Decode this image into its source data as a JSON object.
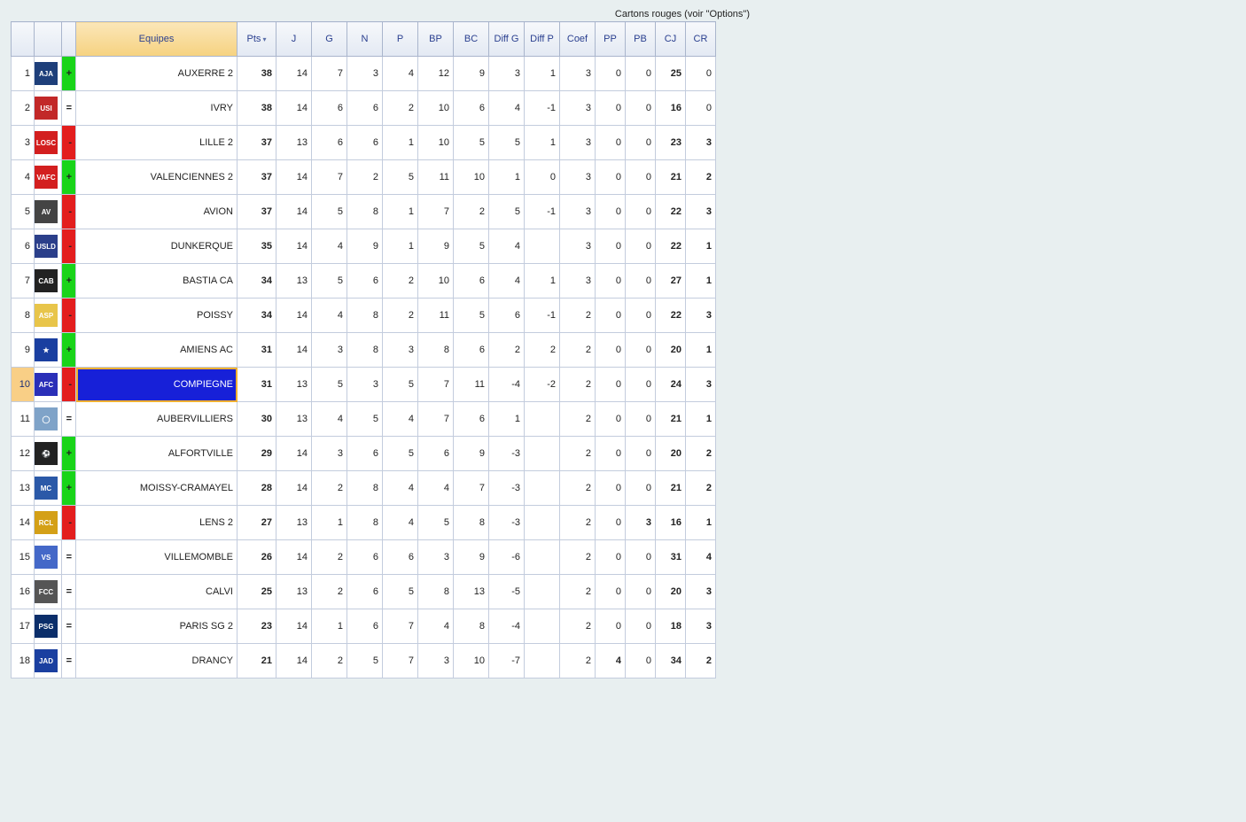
{
  "top_note": "Cartons rouges (voir \"Options\")",
  "columns": {
    "rank": "",
    "logo": "",
    "trend": "",
    "team": "Equipes",
    "pts": "Pts",
    "j": "J",
    "g": "G",
    "n": "N",
    "p": "P",
    "bp": "BP",
    "bc": "BC",
    "diffg": "Diff G",
    "diffp": "Diff P",
    "coef": "Coef",
    "pp": "PP",
    "pb": "PB",
    "cj": "CJ",
    "cr": "CR"
  },
  "sort_indicator": "▾",
  "rows": [
    {
      "rank": 1,
      "trend": "up",
      "team": "AUXERRE 2",
      "pts": 38,
      "j": 14,
      "g": 7,
      "n": 3,
      "p": 4,
      "bp": 12,
      "bc": 9,
      "diffg": 3,
      "diffp": 1,
      "coef": 3,
      "pp": 0,
      "pb": 0,
      "cj": 25,
      "cr": 0,
      "logo_bg": "#1e3f7a",
      "logo_tx": "AJA"
    },
    {
      "rank": 2,
      "trend": "eq",
      "team": "IVRY",
      "pts": 38,
      "j": 14,
      "g": 6,
      "n": 6,
      "p": 2,
      "bp": 10,
      "bc": 6,
      "diffg": 4,
      "diffp": -1,
      "coef": 3,
      "pp": 0,
      "pb": 0,
      "cj": 16,
      "cr": 0,
      "logo_bg": "#c22828",
      "logo_tx": "USI"
    },
    {
      "rank": 3,
      "trend": "down",
      "team": "LILLE 2",
      "pts": 37,
      "j": 13,
      "g": 6,
      "n": 6,
      "p": 1,
      "bp": 10,
      "bc": 5,
      "diffg": 5,
      "diffp": 1,
      "coef": 3,
      "pp": 0,
      "pb": 0,
      "cj": 23,
      "cr": 3,
      "logo_bg": "#d31f1f",
      "logo_tx": "LOSC"
    },
    {
      "rank": 4,
      "trend": "up",
      "team": "VALENCIENNES 2",
      "pts": 37,
      "j": 14,
      "g": 7,
      "n": 2,
      "p": 5,
      "bp": 11,
      "bc": 10,
      "diffg": 1,
      "diffp": 0,
      "coef": 3,
      "pp": 0,
      "pb": 0,
      "cj": 21,
      "cr": 2,
      "logo_bg": "#d31f1f",
      "logo_tx": "VAFC"
    },
    {
      "rank": 5,
      "trend": "down",
      "team": "AVION",
      "pts": 37,
      "j": 14,
      "g": 5,
      "n": 8,
      "p": 1,
      "bp": 7,
      "bc": 2,
      "diffg": 5,
      "diffp": -1,
      "coef": 3,
      "pp": 0,
      "pb": 0,
      "cj": 22,
      "cr": 3,
      "logo_bg": "#444",
      "logo_tx": "AV"
    },
    {
      "rank": 6,
      "trend": "down",
      "team": "DUNKERQUE",
      "pts": 35,
      "j": 14,
      "g": 4,
      "n": 9,
      "p": 1,
      "bp": 9,
      "bc": 5,
      "diffg": 4,
      "diffp": "",
      "coef": 3,
      "pp": 0,
      "pb": 0,
      "cj": 22,
      "cr": 1,
      "logo_bg": "#2b3f8a",
      "logo_tx": "USLD"
    },
    {
      "rank": 7,
      "trend": "up",
      "team": "BASTIA CA",
      "pts": 34,
      "j": 13,
      "g": 5,
      "n": 6,
      "p": 2,
      "bp": 10,
      "bc": 6,
      "diffg": 4,
      "diffp": 1,
      "coef": 3,
      "pp": 0,
      "pb": 0,
      "cj": 27,
      "cr": 1,
      "logo_bg": "#222",
      "logo_tx": "CAB"
    },
    {
      "rank": 8,
      "trend": "down",
      "team": "POISSY",
      "pts": 34,
      "j": 14,
      "g": 4,
      "n": 8,
      "p": 2,
      "bp": 11,
      "bc": 5,
      "diffg": 6,
      "diffp": -1,
      "coef": 2,
      "pp": 0,
      "pb": 0,
      "cj": 22,
      "cr": 3,
      "logo_bg": "#e8c54a",
      "logo_tx": "ASP"
    },
    {
      "rank": 9,
      "trend": "up",
      "team": "AMIENS AC",
      "pts": 31,
      "j": 14,
      "g": 3,
      "n": 8,
      "p": 3,
      "bp": 8,
      "bc": 6,
      "diffg": 2,
      "diffp": 2,
      "coef": 2,
      "pp": 0,
      "pb": 0,
      "cj": 20,
      "cr": 1,
      "logo_bg": "#1a3fa0",
      "logo_tx": "★"
    },
    {
      "rank": 10,
      "trend": "down",
      "team": "COMPIEGNE",
      "pts": 31,
      "j": 13,
      "g": 5,
      "n": 3,
      "p": 5,
      "bp": 7,
      "bc": 11,
      "diffg": -4,
      "diffp": -2,
      "coef": 2,
      "pp": 0,
      "pb": 0,
      "cj": 24,
      "cr": 3,
      "logo_bg": "#2a2fb8",
      "logo_tx": "AFC",
      "selected": true
    },
    {
      "rank": 11,
      "trend": "eq",
      "team": "AUBERVILLIERS",
      "pts": 30,
      "j": 13,
      "g": 4,
      "n": 5,
      "p": 4,
      "bp": 7,
      "bc": 6,
      "diffg": 1,
      "diffp": "",
      "coef": 2,
      "pp": 0,
      "pb": 0,
      "cj": 21,
      "cr": 1,
      "logo_bg": "#7fa3c8",
      "logo_tx": "◯"
    },
    {
      "rank": 12,
      "trend": "up",
      "team": "ALFORTVILLE",
      "pts": 29,
      "j": 14,
      "g": 3,
      "n": 6,
      "p": 5,
      "bp": 6,
      "bc": 9,
      "diffg": -3,
      "diffp": "",
      "coef": 2,
      "pp": 0,
      "pb": 0,
      "cj": 20,
      "cr": 2,
      "logo_bg": "#222",
      "logo_tx": "⚽"
    },
    {
      "rank": 13,
      "trend": "up",
      "team": "MOISSY-CRAMAYEL",
      "pts": 28,
      "j": 14,
      "g": 2,
      "n": 8,
      "p": 4,
      "bp": 4,
      "bc": 7,
      "diffg": -3,
      "diffp": "",
      "coef": 2,
      "pp": 0,
      "pb": 0,
      "cj": 21,
      "cr": 2,
      "logo_bg": "#2b59a8",
      "logo_tx": "MC"
    },
    {
      "rank": 14,
      "trend": "down",
      "team": "LENS 2",
      "pts": 27,
      "j": 13,
      "g": 1,
      "n": 8,
      "p": 4,
      "bp": 5,
      "bc": 8,
      "diffg": -3,
      "diffp": "",
      "coef": 2,
      "pp": 0,
      "pb": 3,
      "cj": 16,
      "cr": 1,
      "logo_bg": "#d4a017",
      "logo_tx": "RCL"
    },
    {
      "rank": 15,
      "trend": "eq",
      "team": "VILLEMOMBLE",
      "pts": 26,
      "j": 14,
      "g": 2,
      "n": 6,
      "p": 6,
      "bp": 3,
      "bc": 9,
      "diffg": -6,
      "diffp": "",
      "coef": 2,
      "pp": 0,
      "pb": 0,
      "cj": 31,
      "cr": 4,
      "logo_bg": "#4468c8",
      "logo_tx": "VS"
    },
    {
      "rank": 16,
      "trend": "eq",
      "team": "CALVI",
      "pts": 25,
      "j": 13,
      "g": 2,
      "n": 6,
      "p": 5,
      "bp": 8,
      "bc": 13,
      "diffg": -5,
      "diffp": "",
      "coef": 2,
      "pp": 0,
      "pb": 0,
      "cj": 20,
      "cr": 3,
      "logo_bg": "#555",
      "logo_tx": "FCC"
    },
    {
      "rank": 17,
      "trend": "eq",
      "team": "PARIS SG 2",
      "pts": 23,
      "j": 14,
      "g": 1,
      "n": 6,
      "p": 7,
      "bp": 4,
      "bc": 8,
      "diffg": -4,
      "diffp": "",
      "coef": 2,
      "pp": 0,
      "pb": 0,
      "cj": 18,
      "cr": 3,
      "logo_bg": "#0b2e6a",
      "logo_tx": "PSG"
    },
    {
      "rank": 18,
      "trend": "eq",
      "team": "DRANCY",
      "pts": 21,
      "j": 14,
      "g": 2,
      "n": 5,
      "p": 7,
      "bp": 3,
      "bc": 10,
      "diffg": -7,
      "diffp": "",
      "coef": 2,
      "pp": 4,
      "pb": 0,
      "cj": 34,
      "cr": 2,
      "logo_bg": "#1a3fa0",
      "logo_tx": "JAD"
    }
  ]
}
